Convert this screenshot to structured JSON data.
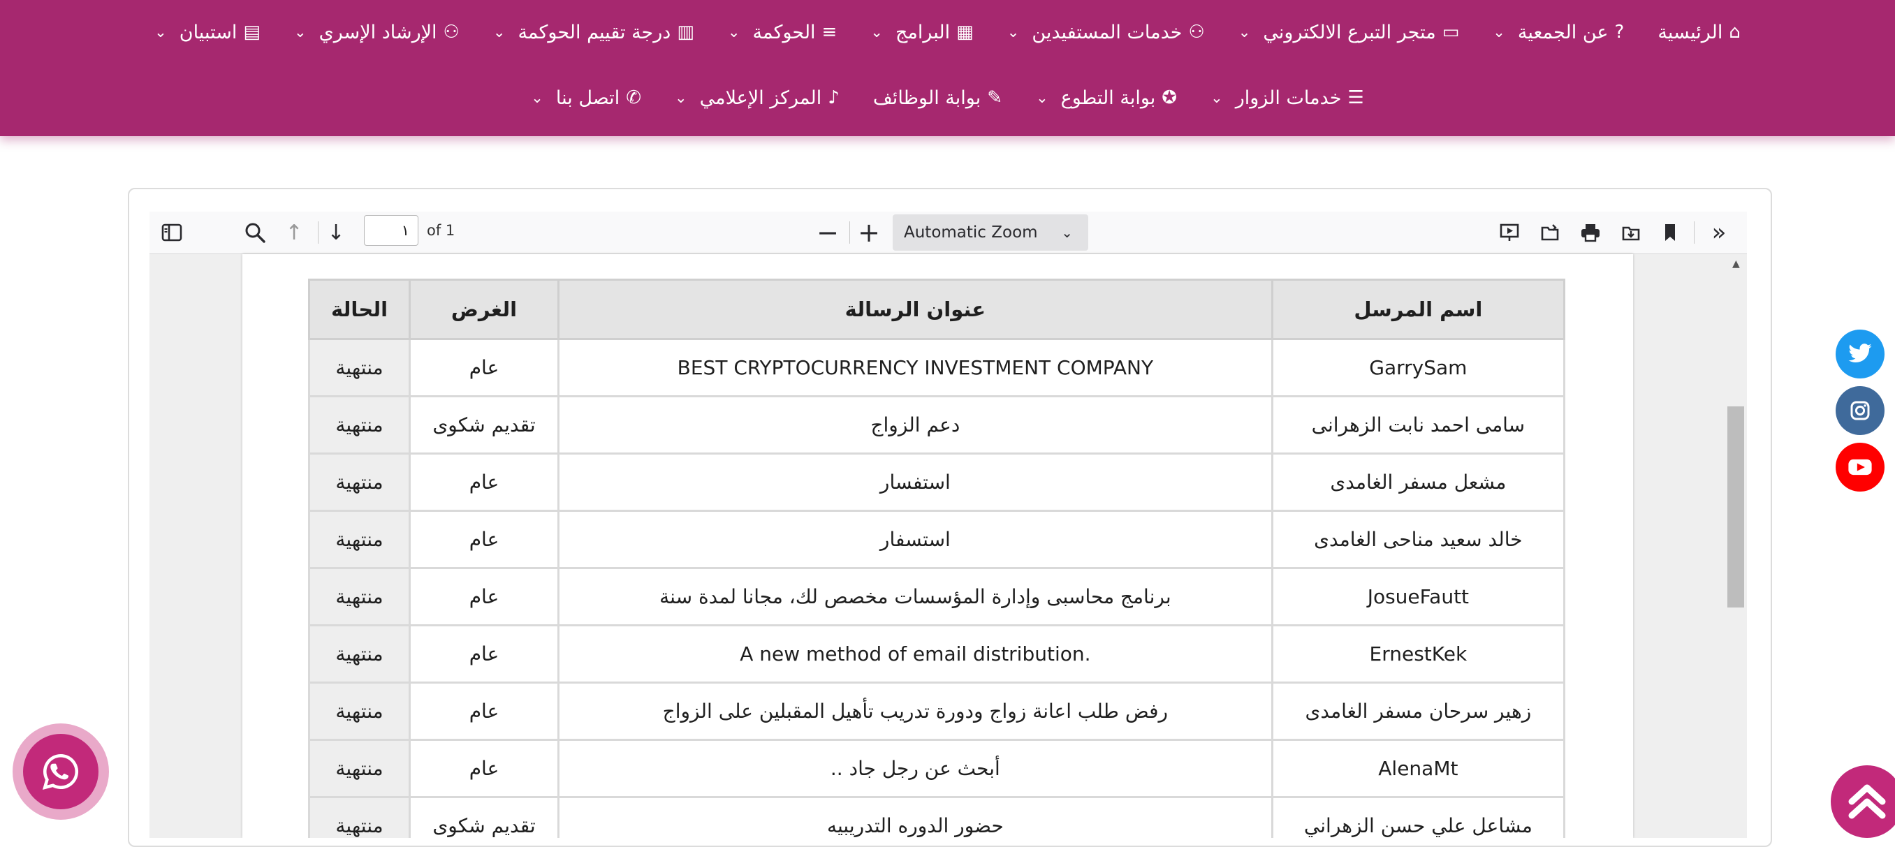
{
  "nav": {
    "row1": [
      {
        "label": "الرئيسية",
        "icon": "home-icon",
        "glyph": "⌂",
        "has_dropdown": false
      },
      {
        "label": "عن الجمعية",
        "icon": "question-icon",
        "glyph": "?",
        "has_dropdown": true
      },
      {
        "label": "متجر التبرع الالكتروني",
        "icon": "card-icon",
        "glyph": "▭",
        "has_dropdown": true
      },
      {
        "label": "خدمات المستفيدين",
        "icon": "users-icon",
        "glyph": "⚇",
        "has_dropdown": true
      },
      {
        "label": "البرامج",
        "icon": "calendar-icon",
        "glyph": "▦",
        "has_dropdown": true
      },
      {
        "label": "الحوكمة",
        "icon": "menu-icon",
        "glyph": "≡",
        "has_dropdown": true
      },
      {
        "label": "درجة تقييم الحوكمة",
        "icon": "chart-icon",
        "glyph": "▥",
        "has_dropdown": true
      },
      {
        "label": "الإرشاد الإسري",
        "icon": "users-icon",
        "glyph": "⚇",
        "has_dropdown": true
      },
      {
        "label": "استبيان",
        "icon": "book-icon",
        "glyph": "▤",
        "has_dropdown": true
      }
    ],
    "row2": [
      {
        "label": "خدمات الزوار",
        "icon": "server-icon",
        "glyph": "☰",
        "has_dropdown": true
      },
      {
        "label": "بوابة التطوع",
        "icon": "award-icon",
        "glyph": "✪",
        "has_dropdown": true
      },
      {
        "label": "بوابة الوظائف",
        "icon": "edit-icon",
        "glyph": "✎",
        "has_dropdown": false
      },
      {
        "label": "المركز الإعلامي",
        "icon": "mic-icon",
        "glyph": "♪",
        "has_dropdown": true
      },
      {
        "label": "اتصل بنا",
        "icon": "phone-icon",
        "glyph": "✆",
        "has_dropdown": true
      }
    ]
  },
  "viewer": {
    "page_value": "١",
    "page_of": "of 1",
    "zoom": "Automatic Zoom"
  },
  "table": {
    "headers": {
      "sender": "اسم المرسل",
      "title": "عنوان الرسالة",
      "purpose": "الغرض",
      "status": "الحالة"
    },
    "rows": [
      {
        "sender": "GarrySam",
        "title": "BEST CRYPTOCURRENCY INVESTMENT COMPANY",
        "purpose": "عام",
        "status": "منتهية"
      },
      {
        "sender": "سامى احمد نابت الزهرانى",
        "title": "دعم الزواج",
        "purpose": "تقديم شكوى",
        "status": "منتهية"
      },
      {
        "sender": "مشعل مسفر الغامدى",
        "title": "استفسار",
        "purpose": "عام",
        "status": "منتهية"
      },
      {
        "sender": "خالد سعيد مناحى الغامدى",
        "title": "استسفار",
        "purpose": "عام",
        "status": "منتهية"
      },
      {
        "sender": "JosueFautt",
        "title": "برنامج محاسبى وإدارة المؤسسات مخصص لك، مجانا لمدة سنة",
        "purpose": "عام",
        "status": "منتهية"
      },
      {
        "sender": "ErnestKek",
        "title": "A new method of email distribution.",
        "purpose": "عام",
        "status": "منتهية"
      },
      {
        "sender": "زهير سرحان مسفر الغامدى",
        "title": "رفض طلب اعانة زواج ودورة تدريب تأهيل المقبلين على الزواج",
        "purpose": "عام",
        "status": "منتهية"
      },
      {
        "sender": "AlenaMt",
        "title": "أبحث عن رجل جاد ..",
        "purpose": "عام",
        "status": "منتهية"
      },
      {
        "sender": "مشاعل علي حسن الزهراني",
        "title": "حضور الدوره التدريبيه",
        "purpose": "تقديم شكوى",
        "status": "منتهية"
      }
    ]
  },
  "colors": {
    "brand": "#a6286f",
    "accent": "#c2297a",
    "twitter": "#1d9bf0",
    "instagram": "#3f6a9b",
    "youtube": "#ff0000"
  },
  "social": [
    "twitter-icon",
    "instagram-icon",
    "youtube-icon"
  ]
}
